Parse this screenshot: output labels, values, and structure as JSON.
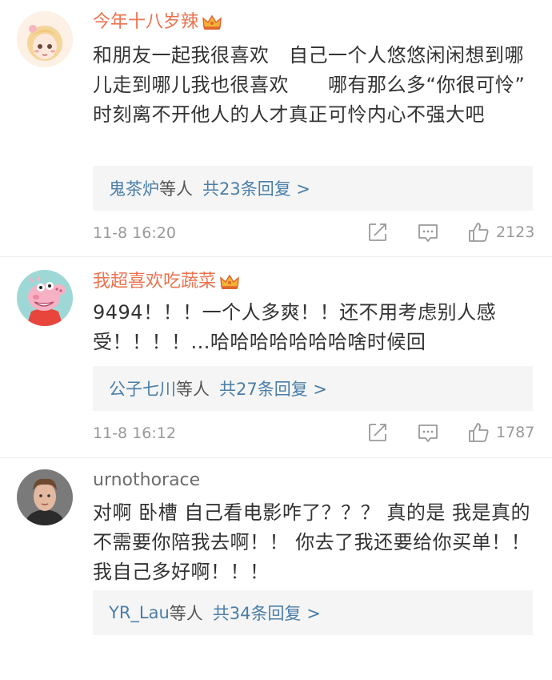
{
  "comments": [
    {
      "username": "今年十八岁辣",
      "text": "和朋友一起我很喜欢　自己一个人悠悠闲闲想到哪儿走到哪儿我也很喜欢　　哪有那么多“你很可怜”　时刻离不开他人的人才真正可怜内心不强大吧",
      "reply_names": "鬼茶炉",
      "reply_etc": "等人",
      "reply_count": "共23条回复 >",
      "time": "11-8 16:20",
      "likes": "2123"
    },
    {
      "username": "我超喜欢吃蔬菜",
      "text": "9494！！！一个人多爽！！还不用考虑别人感受！！！！...哈哈哈哈哈哈哈啥时候回",
      "reply_names": "公子七川",
      "reply_etc": "等人",
      "reply_count": "共27条回复 >",
      "time": "11-8 16:12",
      "likes": "1787"
    },
    {
      "username": "urnothorace",
      "text": "对啊 卧槽 自己看电影咋了？？？ 真的是 我是真的不需要你陪我去啊！！ 你去了我还要给你买单！！我自己多好啊！！！",
      "reply_names": "YR_Lau",
      "reply_etc": "等人",
      "reply_count": "共34条回复 >"
    }
  ],
  "colors": {
    "vip_name": "#eb7350",
    "link": "#4a7ea8",
    "meta": "#999999",
    "reply_bg": "#f5f5f5"
  }
}
